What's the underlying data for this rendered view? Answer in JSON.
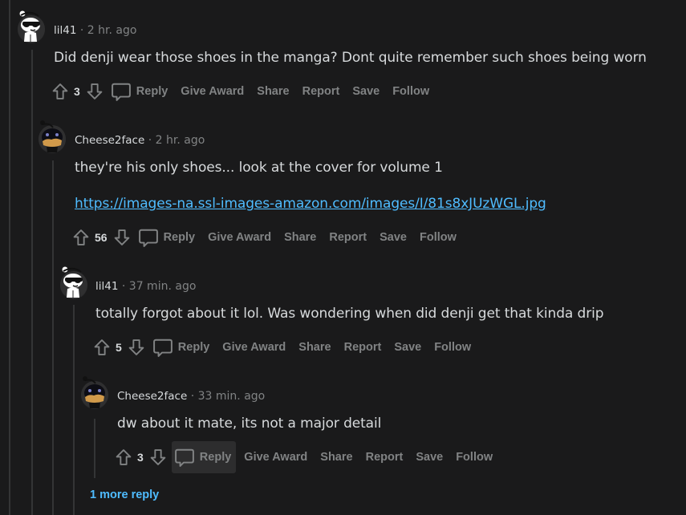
{
  "comments": [
    {
      "username": "lil41",
      "separator": "·",
      "time": "2 hr. ago",
      "text": "Did denji wear those shoes in the manga? Dont quite remember such shoes being worn",
      "score": "3",
      "avatar": "snoo-sunglasses-white"
    },
    {
      "username": "Cheese2face",
      "separator": "·",
      "time": "2 hr. ago",
      "text": "they're his only shoes... look at the cover for volume 1",
      "link": "https://images-na.ssl-images-amazon.com/images/I/81s8xJUzWGL.jpg",
      "score": "56",
      "avatar": "snoo-dark-orange"
    },
    {
      "username": "lil41",
      "separator": "·",
      "time": "37 min. ago",
      "text": "totally forgot about it lol. Was wondering when did denji get that kinda drip",
      "score": "5",
      "avatar": "snoo-sunglasses-white"
    },
    {
      "username": "Cheese2face",
      "separator": "·",
      "time": "33 min. ago",
      "text": "dw about it mate, its not a major detail",
      "score": "3",
      "avatar": "snoo-dark-orange"
    }
  ],
  "actions": {
    "reply": "Reply",
    "give_award": "Give Award",
    "share": "Share",
    "report": "Report",
    "save": "Save",
    "follow": "Follow"
  },
  "more_replies": "1 more reply",
  "colors": {
    "background": "#1a1a1b",
    "text": "#d7dadc",
    "muted": "#818384",
    "link": "#4fbcff",
    "thread_line": "#343536"
  }
}
